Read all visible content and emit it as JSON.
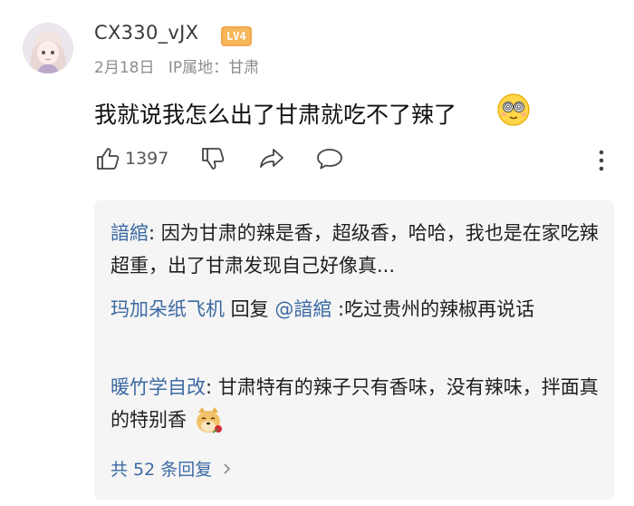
{
  "comment": {
    "username": "CX330_vJX",
    "level_badge": "LV4",
    "date": "2月18日",
    "ip_location": "IP属地：甘肃",
    "text": "我就说我怎么出了甘肃就吃不了辣了",
    "emoji_icon": "dizzy-face-emoji",
    "like_count": "1397"
  },
  "replies": [
    {
      "author": "諳綰",
      "sep": ": ",
      "text": "因为甘肃的辣是香，超级香，哈哈，我也是在家吃辣超重，出了甘肃发现自己好像真..."
    },
    {
      "author": "玛加朵纸飞机",
      "reply_word": " 回复 ",
      "target": "@諳綰",
      "text": " :吃过贵州的辣椒再说话"
    },
    {
      "author": "暖竹学自改",
      "sep": ": ",
      "text": "甘肃特有的辣子只有香味，没有辣味，拌面真的特别香",
      "emoji_icon": "doge-rose-emoji"
    }
  ],
  "more_replies": "共 52 条回复",
  "colors": {
    "link": "#3c6aa3",
    "badge": "#f7b65a",
    "reply_bg": "#f5f5f5"
  }
}
